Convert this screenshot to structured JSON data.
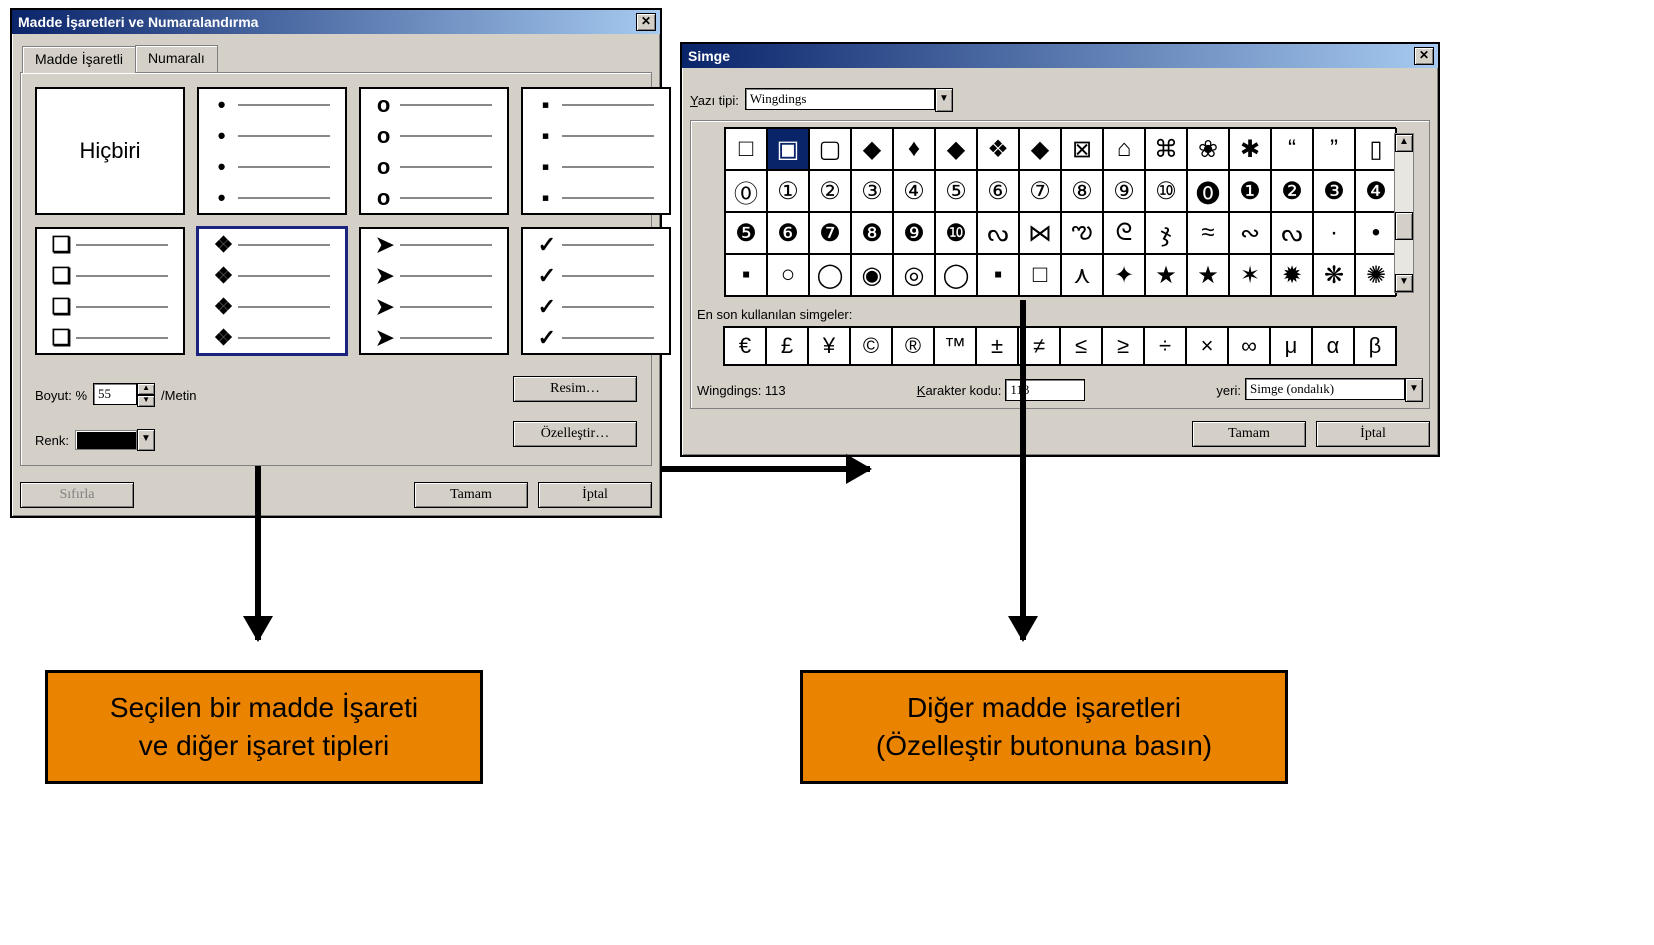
{
  "dlg1": {
    "title": "Madde İşaretleri ve Numaralandırma",
    "tabs": {
      "bulleted": "Madde İşaretli",
      "numbered": "Numaralı"
    },
    "none": "Hiçbiri",
    "options": [
      {
        "marker": "",
        "none": true
      },
      {
        "marker": "•"
      },
      {
        "marker": "o"
      },
      {
        "marker": "▪"
      },
      {
        "marker": "❏"
      },
      {
        "marker": "❖",
        "selected": true
      },
      {
        "marker": "➤"
      },
      {
        "marker": "✓"
      }
    ],
    "size_label": "Boyut: %",
    "size_value": "55",
    "size_suffix": "/Metin",
    "color_label": "Renk:",
    "color_value": "#000000",
    "btn_picture": "Resim…",
    "btn_customize": "Özelleştir…",
    "btn_reset": "Sıfırla",
    "btn_ok": "Tamam",
    "btn_cancel": "İptal"
  },
  "dlg2": {
    "title": "Simge",
    "font_label": "Yazı tipi:",
    "font_value": "Wingdings",
    "symbols": [
      "□",
      "▣",
      "▢",
      "◆",
      "♦",
      "◆",
      "❖",
      "◆",
      "⊠",
      "⌂",
      "⌘",
      "❀",
      "✱",
      "“",
      "”",
      "▯",
      "⓪",
      "①",
      "②",
      "③",
      "④",
      "⑤",
      "⑥",
      "⑦",
      "⑧",
      "⑨",
      "⑩",
      "⓿",
      "❶",
      "❷",
      "❸",
      "❹",
      "❺",
      "❻",
      "❼",
      "❽",
      "❾",
      "❿",
      "ᔓ",
      "⋈",
      "ఌ",
      "ᘓ",
      "ჯ",
      "≈",
      "∾",
      "ᔓ",
      "·",
      "•",
      "▪",
      "○",
      "◯",
      "◉",
      "◎",
      "◯",
      "▪",
      "□",
      "⋏",
      "✦",
      "★",
      "★",
      "✶",
      "✹",
      "❋",
      "✺"
    ],
    "selected_index": 1,
    "recent_label": "En son kullanılan simgeler:",
    "recent": [
      "€",
      "£",
      "¥",
      "©",
      "®",
      "™",
      "±",
      "≠",
      "≤",
      "≥",
      "÷",
      "×",
      "∞",
      "μ",
      "α",
      "β"
    ],
    "font_info": "Wingdings: 113",
    "charcode_label": "Karakter kodu:",
    "charcode_value": "113",
    "from_label": "yeri:",
    "from_value": "Simge (ondalık)",
    "btn_ok": "Tamam",
    "btn_cancel": "İptal"
  },
  "callouts": {
    "left_line1": "Seçilen bir madde İşareti",
    "left_line2": "ve diğer işaret tipleri",
    "right_line1": "Diğer madde işaretleri",
    "right_line2": "(Özelleştir butonuna basın)"
  }
}
